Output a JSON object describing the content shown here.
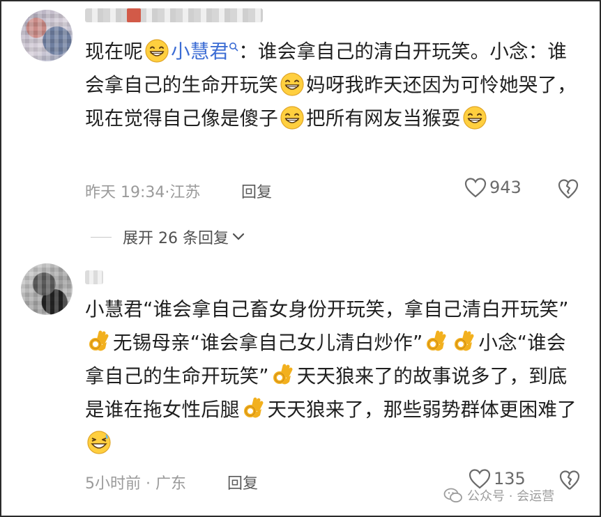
{
  "comments": [
    {
      "avatar_icon": "avatar",
      "segments": [
        {
          "type": "text",
          "text": "现在呢"
        },
        {
          "type": "emoji",
          "icon": "grin-emoji"
        },
        {
          "type": "mention",
          "text": "小慧君"
        },
        {
          "type": "text",
          "text": "：谁会拿自己的清白开玩笑。小念：谁会拿自己的生命开玩笑"
        },
        {
          "type": "emoji",
          "icon": "grin-emoji"
        },
        {
          "type": "text",
          "text": "妈呀我昨天还因为可怜她哭了，现在觉得自己像是傻子"
        },
        {
          "type": "emoji",
          "icon": "grin-emoji"
        },
        {
          "type": "text",
          "text": "把所有网友当猴耍"
        },
        {
          "type": "emoji",
          "icon": "grin-emoji"
        }
      ],
      "time": "昨天 19:34",
      "location": "江苏",
      "reply_label": "回复",
      "likes": "943"
    },
    {
      "avatar_icon": "avatar",
      "segments": [
        {
          "type": "text",
          "text": "小慧君“谁会拿自己畜女身份开玩笑，拿自己清白开玩笑”"
        },
        {
          "type": "emoji",
          "icon": "ok-hand-emoji"
        },
        {
          "type": "text",
          "text": "无锡母亲“谁会拿自己女儿清白炒作”"
        },
        {
          "type": "emoji",
          "icon": "ok-hand-emoji"
        },
        {
          "type": "emoji",
          "icon": "ok-hand-emoji"
        },
        {
          "type": "text",
          "text": "小念“谁会拿自己的生命开玩笑”"
        },
        {
          "type": "emoji",
          "icon": "ok-hand-emoji"
        },
        {
          "type": "text",
          "text": "天天狼来了的故事说多了，到底是谁在拖女性后腿"
        },
        {
          "type": "emoji",
          "icon": "ok-hand-emoji"
        },
        {
          "type": "text",
          "text": "天天狼来了，那些弱势群体更困难了"
        },
        {
          "type": "emoji",
          "icon": "laugh-tears-emoji"
        }
      ],
      "time": "5小时前",
      "location": "广东",
      "reply_label": "回复",
      "likes": "135"
    }
  ],
  "expand_replies": "展开 26 条回复",
  "watermark": "公众号 · 会运营",
  "colors": {
    "mention": "#3b6cd4",
    "meta": "#9a9a9a",
    "text": "#1f1f1f"
  }
}
